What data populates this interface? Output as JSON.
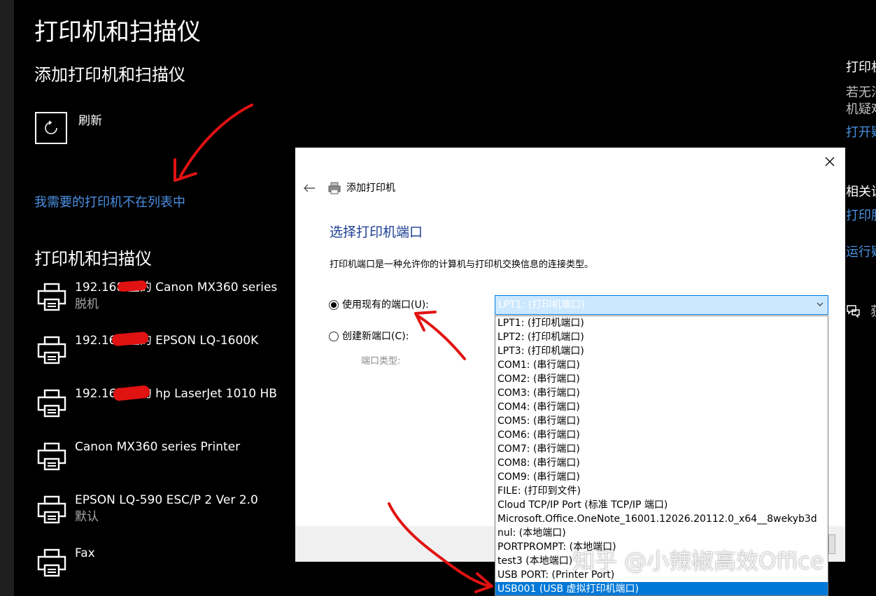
{
  "settings": {
    "title": "打印机和扫描仪",
    "add_heading": "添加打印机和扫描仪",
    "refresh_label": "刷新",
    "missing_printer_link": "我需要的打印机不在列表中",
    "list_heading": "打印机和扫描仪",
    "printers": [
      {
        "name": "192.168 上的 Canon MX360 series",
        "status": "脱机"
      },
      {
        "name": "192.168 上的 EPSON LQ-1600K",
        "status": ""
      },
      {
        "name": "192.168 上的 hp LaserJet 1010 HB",
        "status": ""
      },
      {
        "name": "Canon MX360 series Printer",
        "status": ""
      },
      {
        "name": "EPSON LQ-590 ESC/P 2 Ver 2.0",
        "status": "默认"
      },
      {
        "name": "Fax",
        "status": ""
      }
    ]
  },
  "side_panel": {
    "line1": "打印机",
    "line2": "若无法",
    "line3": "机疑难",
    "link1": "打开疑",
    "related": "相关设",
    "link2": "打印服",
    "link3": "运行疑",
    "feedback": "获"
  },
  "dialog": {
    "window_title": "添加打印机",
    "heading": "选择打印机端口",
    "description": "打印机端口是一种允许你的计算机与打印机交换信息的连接类型。",
    "use_existing_label": "使用现有的端口(U):",
    "create_new_label": "创建新端口(C):",
    "port_type_label": "端口类型:",
    "selected_port": "LPT1: (打印机端口)",
    "port_options": [
      "LPT1: (打印机端口)",
      "LPT2: (打印机端口)",
      "LPT3: (打印机端口)",
      "COM1: (串行端口)",
      "COM2: (串行端口)",
      "COM3: (串行端口)",
      "COM4: (串行端口)",
      "COM5: (串行端口)",
      "COM6: (串行端口)",
      "COM7: (串行端口)",
      "COM8: (串行端口)",
      "COM9: (串行端口)",
      "FILE: (打印到文件)",
      "Cloud TCP/IP Port (标准 TCP/IP 端口)",
      "Microsoft.Office.OneNote_16001.12026.20112.0_x64__8wekyb3d",
      "nul: (本地端口)",
      "PORTPROMPT: (本地端口)",
      "test3 (本地端口)",
      "USB PORT: (Printer Port)",
      "USB001 (USB 虚拟打印机端口)"
    ],
    "highlighted_index": 19
  },
  "watermark": "知乎 @小辣椒高效Office",
  "colors": {
    "background": "#000000",
    "link_blue": "#4a90e2",
    "dialog_heading": "#1c3f94",
    "selection_blue": "#0078d7",
    "combo_bg": "#cce8ff",
    "annotation_red": "#e11212"
  }
}
